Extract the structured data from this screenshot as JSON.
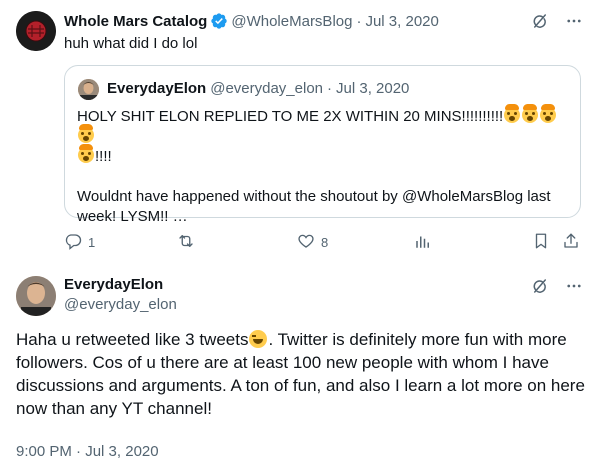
{
  "tweet1": {
    "name": "Whole Mars Catalog",
    "handle": "@WholeMarsBlog",
    "separator": "·",
    "date": "Jul 3, 2020",
    "text": "huh what did I do lol"
  },
  "quote": {
    "name": "EverydayElon",
    "handle": "@everyday_elon",
    "separator": "·",
    "date": "Jul 3, 2020",
    "line1": "HOLY SHIT ELON REPLIED TO ME 2X WITHIN 20 MINS!!!!!!!!!!",
    "line1_tail": "!!!!",
    "line2": "Wouldnt have happened without the shoutout by @WholeMarsBlog last week! LYSM!! …"
  },
  "actions": {
    "reply_count": "1",
    "like_count": "8"
  },
  "tweet2": {
    "name": "EverydayElon",
    "handle": "@everyday_elon",
    "text_before_emoji": "Haha u retweeted like 3 tweets",
    "text_after_emoji": ". Twitter is definitely more fun with more followers. Cos of u there are at least 100 new people with whom I have discussions and arguments. A ton of fun, and also I learn a lot more on here now than any YT channel!",
    "time": "9:00 PM",
    "separator": "·",
    "date": "Jul 3, 2020"
  },
  "icons": {
    "verified": "verified-badge-icon",
    "grok": "grok-icon",
    "more": "more-icon",
    "reply": "reply-icon",
    "retweet": "retweet-icon",
    "like": "like-icon",
    "views": "views-icon",
    "bookmark": "bookmark-icon",
    "share": "share-icon"
  },
  "colors": {
    "text": "#0f1419",
    "muted": "#536471",
    "verified": "#1d9bf0",
    "border": "#cfd9de"
  }
}
